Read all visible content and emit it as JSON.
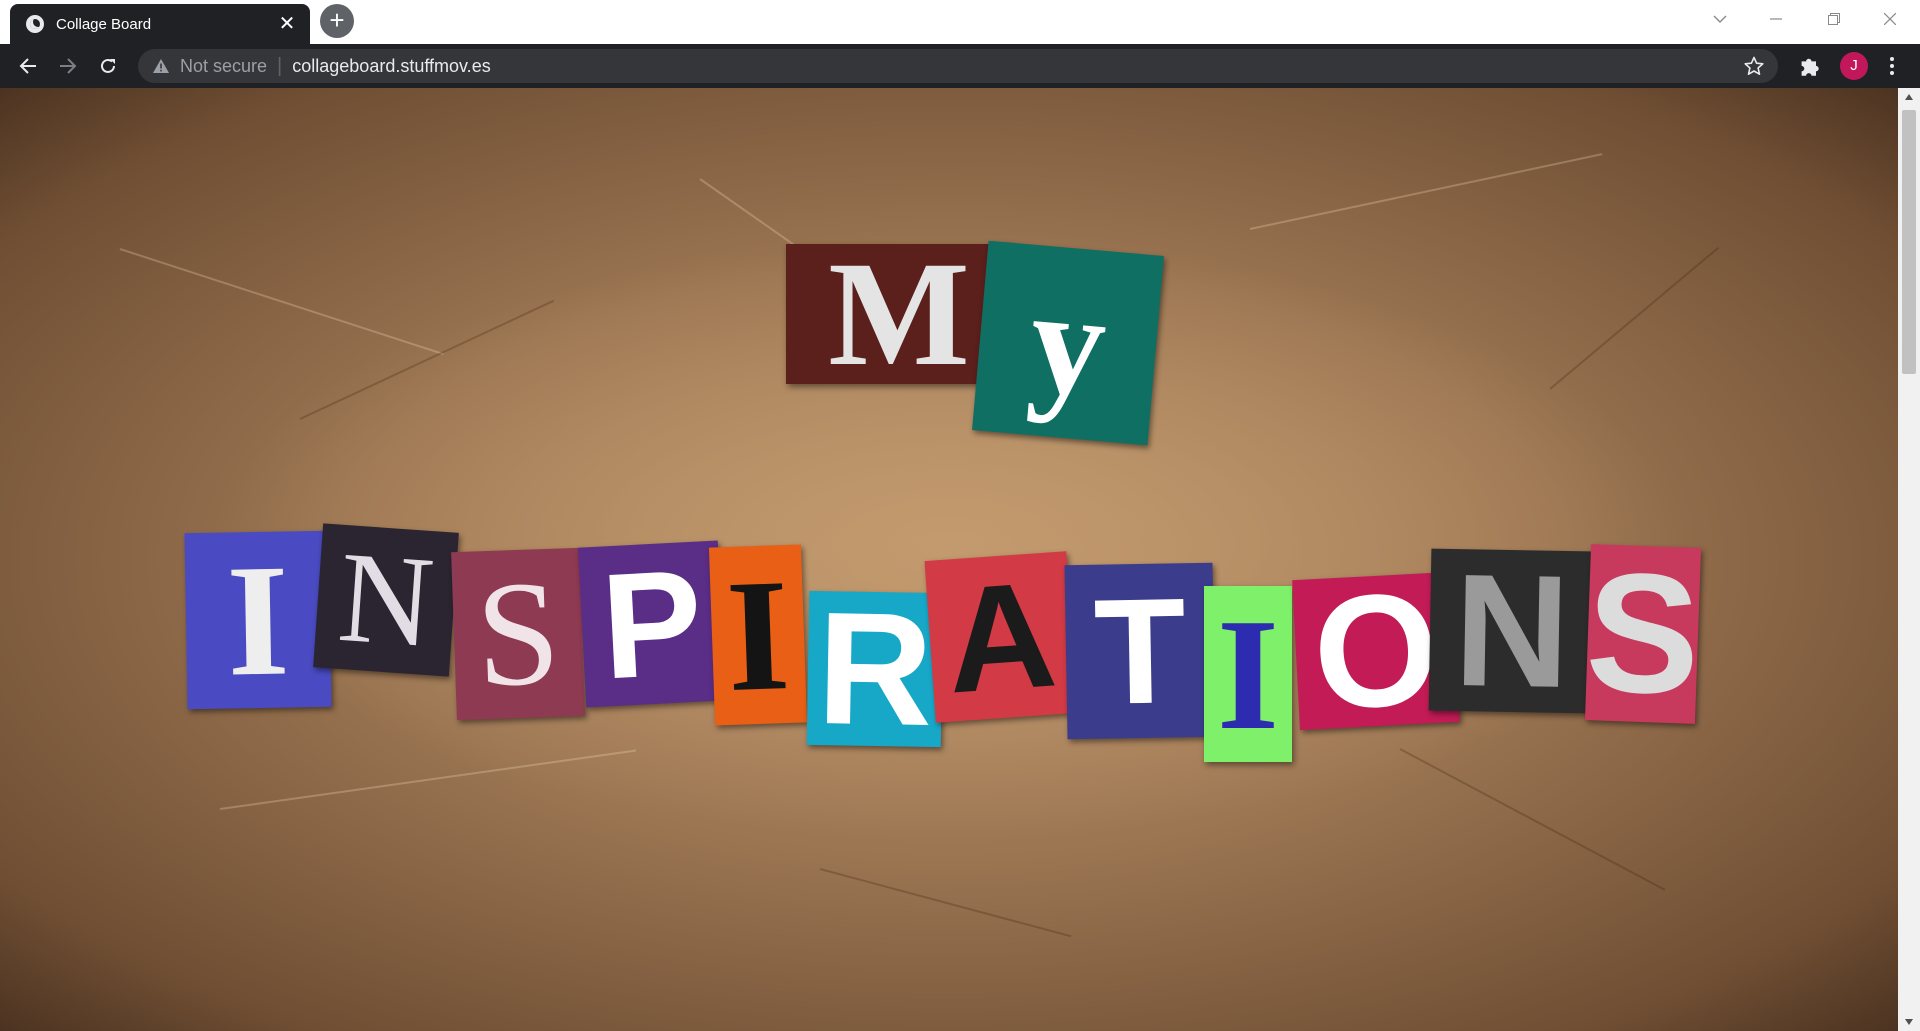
{
  "browser": {
    "tab": {
      "title": "Collage Board",
      "close_label": "✕"
    },
    "new_tab_label": "+",
    "omnibox": {
      "security_label": "Not secure",
      "separator": "|",
      "url": "collageboard.stuffmov.es"
    },
    "profile_initial": "J"
  },
  "page": {
    "heading_line1": "MY",
    "heading_line2": "INSPIRATIONS",
    "letters": [
      {
        "char": "M",
        "bg": "#5b1f1c",
        "fg": "#e4e4e4"
      },
      {
        "char": "y",
        "bg": "#0f6f63",
        "fg": "#ffffff"
      },
      {
        "char": "I",
        "bg": "#4a4bc2",
        "fg": "#eeeeee"
      },
      {
        "char": "N",
        "bg": "#2a2530",
        "fg": "#e2dde5"
      },
      {
        "char": "S",
        "bg": "#8e3a52",
        "fg": "#f0e4e8"
      },
      {
        "char": "P",
        "bg": "#5a2d86",
        "fg": "#ffffff"
      },
      {
        "char": "I",
        "bg": "#e85f15",
        "fg": "#141414"
      },
      {
        "char": "R",
        "bg": "#17a8c8",
        "fg": "#ffffff"
      },
      {
        "char": "A",
        "bg": "#d23a45",
        "fg": "#1b1b1b"
      },
      {
        "char": "T",
        "bg": "#3c3c8c",
        "fg": "#ffffff"
      },
      {
        "char": "I",
        "bg": "#7ef06a",
        "fg": "#2d2bb0"
      },
      {
        "char": "O",
        "bg": "#c21b55",
        "fg": "#ffffff"
      },
      {
        "char": "N",
        "bg": "#2c2c2c",
        "fg": "#9a9a9a"
      },
      {
        "char": "S",
        "bg": "#c73a5d",
        "fg": "#dcdcdc"
      }
    ]
  }
}
